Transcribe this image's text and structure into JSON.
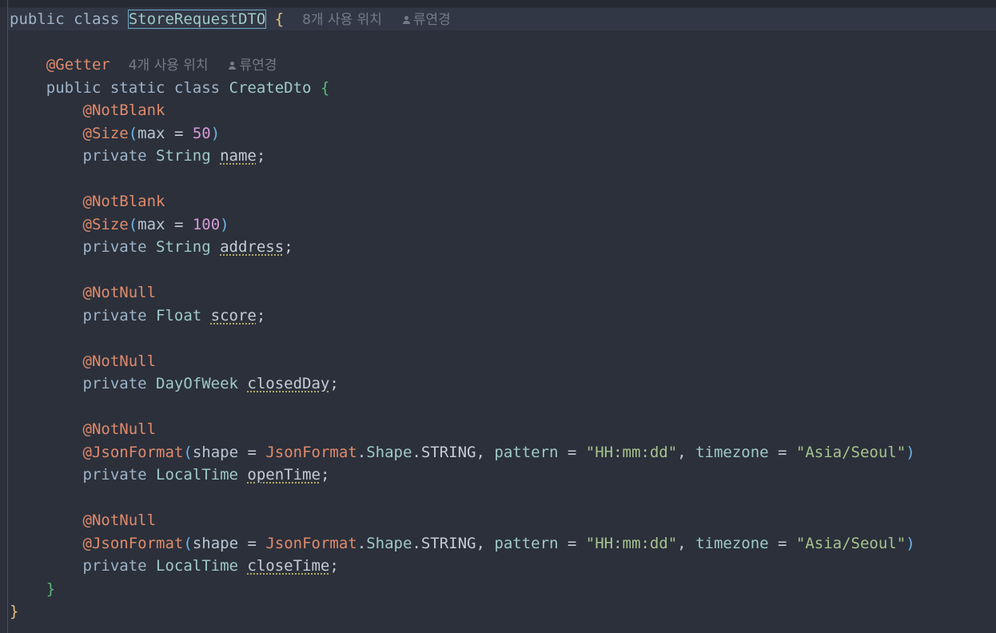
{
  "code": {
    "l1": {
      "kw": "public class ",
      "cls": "StoreRequestDTO",
      "brace": " {",
      "hint": "8개 사용 위치",
      "author": "류연경"
    },
    "l3": {
      "ann": "@Getter",
      "hint": "4개 사용 위치",
      "author": "류연경"
    },
    "l4": {
      "kw": "public static class ",
      "cls": "CreateDto ",
      "brace": "{"
    },
    "l5": {
      "ann": "@NotBlank"
    },
    "l6": {
      "ann": "@Size",
      "open": "(",
      "param": "max",
      "eq": " = ",
      "num": "50",
      "close": ")"
    },
    "l7": {
      "kw": "private ",
      "type": "String ",
      "field": "name",
      "semi": ";"
    },
    "l9": {
      "ann": "@NotBlank"
    },
    "l10": {
      "ann": "@Size",
      "open": "(",
      "param": "max",
      "eq": " = ",
      "num": "100",
      "close": ")"
    },
    "l11": {
      "kw": "private ",
      "type": "String ",
      "field": "address",
      "semi": ";"
    },
    "l13": {
      "ann": "@NotNull"
    },
    "l14": {
      "kw": "private ",
      "type": "Float ",
      "field": "score",
      "semi": ";"
    },
    "l16": {
      "ann": "@NotNull"
    },
    "l17": {
      "kw": "private ",
      "type": "DayOfWeek ",
      "field": "closedDay",
      "semi": ";"
    },
    "l19": {
      "ann": "@NotNull"
    },
    "l20": {
      "ann": "@JsonFormat",
      "open": "(",
      "p1": "shape",
      "eq1": " = ",
      "enumcls": "JsonFormat",
      "dot1": ".",
      "shape": "Shape",
      "dot2": ".",
      "string": "STRING",
      "comma1": ", ",
      "p2": "pattern",
      "eq2": " = ",
      "pattern": "\"HH:mm:dd\"",
      "comma2": ", ",
      "p3": "timezone",
      "eq3": " = ",
      "tz": "\"Asia/Seoul\"",
      "close": ")"
    },
    "l21": {
      "kw": "private ",
      "type": "LocalTime ",
      "field": "openTime",
      "semi": ";"
    },
    "l23": {
      "ann": "@NotNull"
    },
    "l24": {
      "ann": "@JsonFormat",
      "open": "(",
      "p1": "shape",
      "eq1": " = ",
      "enumcls": "JsonFormat",
      "dot1": ".",
      "shape": "Shape",
      "dot2": ".",
      "string": "STRING",
      "comma1": ", ",
      "p2": "pattern",
      "eq2": " = ",
      "pattern": "\"HH:mm:dd\"",
      "comma2": ", ",
      "p3": "timezone",
      "eq3": " = ",
      "tz": "\"Asia/Seoul\"",
      "close": ")"
    },
    "l25": {
      "kw": "private ",
      "type": "LocalTime ",
      "field": "closeTime",
      "semi": ";"
    },
    "l26": {
      "brace": "}"
    },
    "l27": {
      "brace": "}"
    }
  },
  "icons": {
    "author": "person-icon"
  }
}
